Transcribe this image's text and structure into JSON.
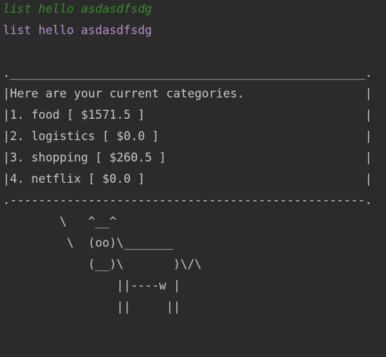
{
  "terminal": {
    "input_echo": "list hello asdasdfsdg",
    "user_command": "list hello asdasdfsdg",
    "output_lines": [
      ".__________________________________________________.",
      "|Here are your current categories.                 |",
      "|1. food [ $1571.5 ]                               |",
      "|2. logistics [ $0.0 ]                             |",
      "|3. shopping [ $260.5 ]                            |",
      "|4. netflix [ $0.0 ]                               |",
      ".--------------------------------------------------.",
      "        \\   ^__^",
      "         \\  (oo)\\_______",
      "            (__)\\       )\\/\\",
      "                ||----w |",
      "                ||     ||"
    ]
  },
  "colors": {
    "background": "#2b2b2b",
    "input_echo": "#3a8a2e",
    "user_command": "#b38fc7",
    "output_text": "#c8c8c8"
  }
}
